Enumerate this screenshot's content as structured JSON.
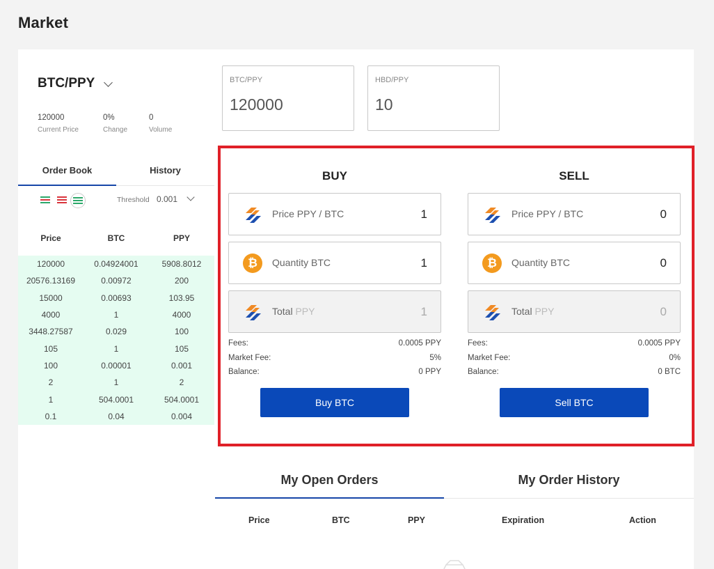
{
  "page": {
    "title": "Market"
  },
  "pair": {
    "name": "BTC/PPY"
  },
  "stats": [
    {
      "value": "120000",
      "label": "Current Price"
    },
    {
      "value": "0%",
      "label": "Change"
    },
    {
      "value": "0",
      "label": "Volume"
    }
  ],
  "orderbook": {
    "tabs": [
      {
        "label": "Order Book"
      },
      {
        "label": "History"
      }
    ],
    "threshold_label": "Threshold",
    "threshold_value": "0.001",
    "columns": [
      "Price",
      "BTC",
      "PPY"
    ],
    "rows": [
      [
        "120000",
        "0.04924001",
        "5908.8012"
      ],
      [
        "20576.13169",
        "0.00972",
        "200"
      ],
      [
        "15000",
        "0.00693",
        "103.95"
      ],
      [
        "4000",
        "1",
        "4000"
      ],
      [
        "3448.27587",
        "0.029",
        "100"
      ],
      [
        "105",
        "1",
        "105"
      ],
      [
        "100",
        "0.00001",
        "0.001"
      ],
      [
        "2",
        "1",
        "2"
      ],
      [
        "1",
        "504.0001",
        "504.0001"
      ],
      [
        "0.1",
        "0.04",
        "0.004"
      ]
    ]
  },
  "cards": [
    {
      "label": "BTC/PPY",
      "value": "120000"
    },
    {
      "label": "HBD/PPY",
      "value": "10"
    }
  ],
  "buy": {
    "title": "BUY",
    "price_label": "Price PPY / BTC",
    "price_value": "1",
    "qty_label": "Quantity BTC",
    "qty_value": "1",
    "total_label": "Total",
    "total_unit": "PPY",
    "total_value": "1",
    "fees_label": "Fees:",
    "fees_value": "0.0005 PPY",
    "market_fee_label": "Market Fee:",
    "market_fee_value": "5%",
    "balance_label": "Balance:",
    "balance_value": "0 PPY",
    "button": "Buy BTC"
  },
  "sell": {
    "title": "SELL",
    "price_label": "Price PPY / BTC",
    "price_value": "0",
    "qty_label": "Quantity BTC",
    "qty_value": "0",
    "total_label": "Total",
    "total_unit": "PPY",
    "total_value": "0",
    "fees_label": "Fees:",
    "fees_value": "0.0005 PPY",
    "market_fee_label": "Market Fee:",
    "market_fee_value": "0%",
    "balance_label": "Balance:",
    "balance_value": "0 BTC",
    "button": "Sell BTC"
  },
  "orders": {
    "tabs": [
      {
        "label": "My Open Orders"
      },
      {
        "label": "My Order History"
      }
    ],
    "columns": [
      "Price",
      "BTC",
      "PPY",
      "Expiration",
      "Action"
    ]
  },
  "colors": {
    "accent": "#0a49b9",
    "highlight_border": "#e02028",
    "orderbook_bg": "#e5fcf1",
    "btc_orange": "#f39a1e"
  },
  "icons": {
    "ppy": "ppy-logo-icon",
    "btc": "bitcoin-icon"
  }
}
